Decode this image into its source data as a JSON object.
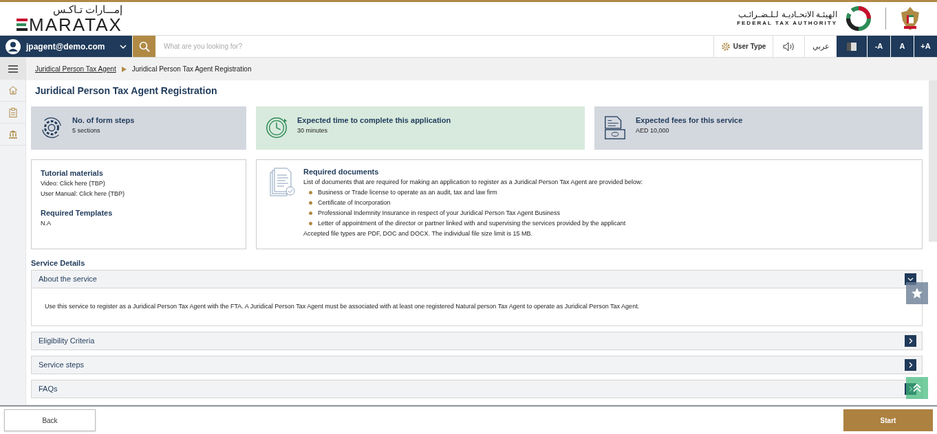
{
  "header": {
    "logo_arabic": "إمـــارات تـاكـس",
    "logo_text": "MARATAX",
    "authority_arabic": "الهيئـة الاتحـاديـة لـلـضـرائـب",
    "authority_english": "FEDERAL TAX AUTHORITY"
  },
  "toolbar": {
    "user": "jpagent@demo.com",
    "search_placeholder": "What are you looking for?",
    "user_type": "User Type",
    "language": "عربي",
    "font_buttons": [
      "-A",
      "A",
      "+A"
    ]
  },
  "breadcrumb": [
    {
      "label": "Juridical Person Tax Agent",
      "link": true
    },
    {
      "label": "Juridical Person Tax Agent Registration",
      "link": false
    }
  ],
  "title": "Juridical Person Tax Agent Registration",
  "summary_cards": [
    {
      "kind": "steps",
      "title": "No. of form steps",
      "value": "5 sections"
    },
    {
      "kind": "time",
      "title": "Expected time to complete this application",
      "value": "30 minutes"
    },
    {
      "kind": "fees",
      "title": "Expected fees for this service",
      "value": "AED 10,000"
    }
  ],
  "tutorial": {
    "heading": "Tutorial materials",
    "lines": [
      "Video: Click here (TBP)",
      "User Manual: Click here (TBP)"
    ],
    "templates_heading": "Required Templates",
    "templates_value": "N.A"
  },
  "documents": {
    "heading": "Required documents",
    "intro": "List of documents that are required for making an application to register as a Juridical Person Tax Agent are provided below:",
    "items": [
      "Business or Trade license to operate as an audit, tax and law firm",
      "Certificate of Incorporation",
      "Professional Indemnity Insurance in respect of your Juridical Person Tax Agent Business",
      "Letter of appointment of the director or partner linked with and supervising the services provided by the applicant"
    ],
    "note": "Accepted file types are PDF, DOC and DOCX. The individual file size limit is 15 MB."
  },
  "service_details": {
    "heading": "Service Details",
    "sections": [
      {
        "title": "About the service",
        "expanded": true,
        "body": "Use this service to register as a Juridical Person Tax Agent with the FTA. A Juridical Person Tax Agent must be associated with at least one registered Natural person Tax Agent to operate as Juridical Person Tax Agent."
      },
      {
        "title": "Eligibility Criteria",
        "expanded": false
      },
      {
        "title": "Service steps",
        "expanded": false
      },
      {
        "title": "FAQs",
        "expanded": false
      }
    ]
  },
  "footer": {
    "back": "Back",
    "start": "Start"
  }
}
